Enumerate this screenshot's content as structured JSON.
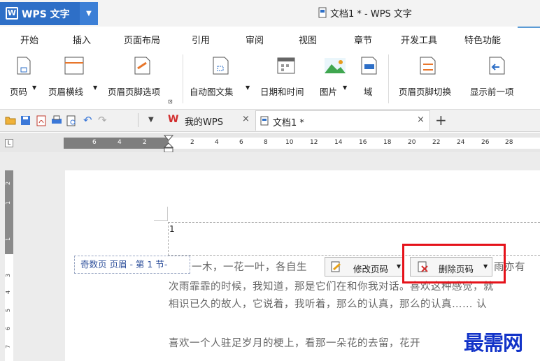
{
  "app": {
    "name": "WPS 文字",
    "logo": "W",
    "window_title": "文档1 * - WPS 文字"
  },
  "menu": [
    "开始",
    "插入",
    "页面布局",
    "引用",
    "审阅",
    "视图",
    "章节",
    "开发工具",
    "特色功能"
  ],
  "ribbon": {
    "page_num": "页码",
    "header_line": "页眉横线",
    "header_options": "页眉页脚选项",
    "auto_text": "自动图文集",
    "date_time": "日期和时间",
    "picture": "图片",
    "field": "域",
    "switch": "页眉页脚切换",
    "show_prev": "显示前一项"
  },
  "tabs": {
    "mywps": "我的WPS",
    "doc": "文档1 *",
    "close": "×",
    "add": "+"
  },
  "ruler_top": [
    "6",
    "4",
    "2",
    "2",
    "4",
    "6",
    "8",
    "10",
    "12",
    "14",
    "16",
    "18",
    "20",
    "22",
    "24",
    "26",
    "28"
  ],
  "ruler_left": [
    "2",
    "1",
    "1",
    "3",
    "4",
    "5",
    "6",
    "7"
  ],
  "header": {
    "page_number": "1",
    "label": "奇数页 页眉 - 第 1 节-",
    "modify_btn": "修改页码",
    "delete_btn": "删除页码"
  },
  "body": {
    "line1_a": "一木，一花一叶，各自生",
    "line1_b": "雨亦有",
    "line2": "次雨霏霏的时候，我知道，那是它们在和你我对话。喜欢这种感觉，就",
    "line3": "相识已久的故人，它说着，我听着，那么的认真，那么的认真…… 认",
    "line4": "喜欢一个人驻足岁月的梗上，看那一朵花的去留，花开"
  },
  "watermark": "最需网",
  "colors": {
    "accent": "#2e6fc7",
    "highlight": "#e5121a",
    "watermark": "#1233c8"
  }
}
